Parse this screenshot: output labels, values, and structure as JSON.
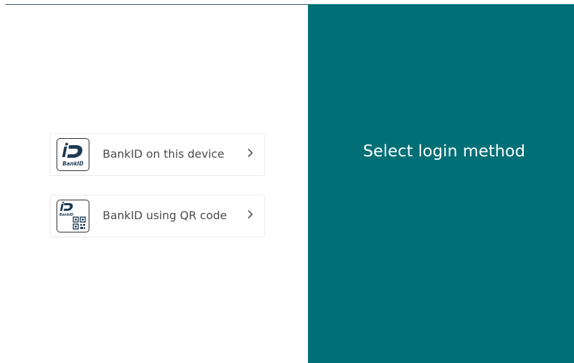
{
  "login": {
    "title": "Select login method",
    "options": [
      {
        "label": "BankID on this device",
        "logo_text": "BankID",
        "icon": "bankid-logo-icon"
      },
      {
        "label": "BankID using QR code",
        "logo_text": "BankID",
        "icon": "bankid-qr-logo-icon"
      }
    ]
  },
  "colors": {
    "accent_panel": "#016f76",
    "title_text": "#ffffff",
    "option_text": "#4a4a4a",
    "logo_ink": "#1d3a52"
  }
}
